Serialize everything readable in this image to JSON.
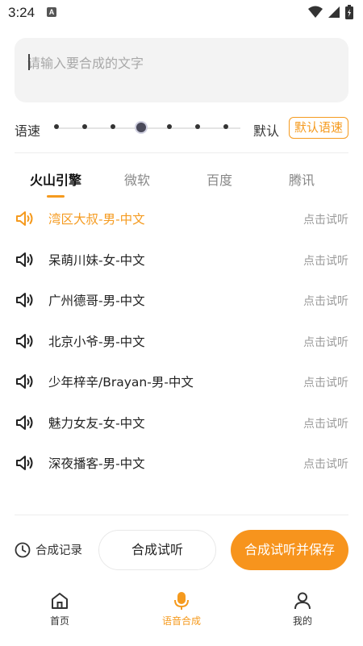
{
  "status_bar": {
    "time": "3:24",
    "notif_letter": "A"
  },
  "input": {
    "placeholder": "请输入要合成的文字",
    "value": ""
  },
  "speed": {
    "label": "语速",
    "current_value": "默认",
    "default_button": "默认语速",
    "steps": 7,
    "selected_index": 3
  },
  "tabs": [
    {
      "label": "火山引擎",
      "active": true
    },
    {
      "label": "微软",
      "active": false
    },
    {
      "label": "百度",
      "active": false
    },
    {
      "label": "腾讯",
      "active": false
    }
  ],
  "voices": [
    {
      "name": "湾区大叔-男-中文",
      "action": "点击试听",
      "active": true
    },
    {
      "name": "呆萌川妹-女-中文",
      "action": "点击试听",
      "active": false
    },
    {
      "name": "广州德哥-男-中文",
      "action": "点击试听",
      "active": false
    },
    {
      "name": "北京小爷-男-中文",
      "action": "点击试听",
      "active": false
    },
    {
      "name": "少年梓辛/Brayan-男-中文",
      "action": "点击试听",
      "active": false
    },
    {
      "name": "魅力女友-女-中文",
      "action": "点击试听",
      "active": false
    },
    {
      "name": "深夜播客-男-中文",
      "action": "点击试听",
      "active": false
    }
  ],
  "actions": {
    "history": "合成记录",
    "try_synth": "合成试听",
    "try_and_save": "合成试听并保存"
  },
  "nav": {
    "home": "首页",
    "synth": "语音合成",
    "mine": "我的"
  },
  "colors": {
    "accent": "#f59a1e",
    "button_fill": "#f7941d"
  }
}
